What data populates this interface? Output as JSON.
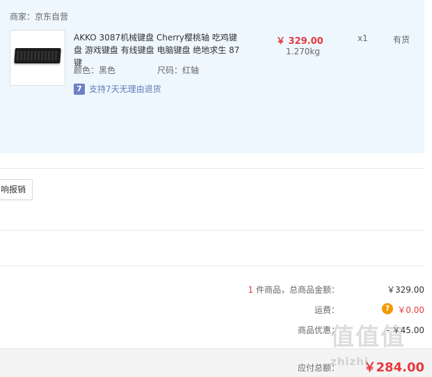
{
  "seller": "商家：京东自营",
  "product": {
    "title": "AKKO 3087机械键盘 Cherry樱桃轴 吃鸡键盘 游戏键盘 有线键盘 电脑键盘 绝地求生 87键",
    "color": "颜色：黑色",
    "size": "尺码：红轴",
    "return_icon_text": "7",
    "return_policy": "支持7天无理由退货",
    "price": "￥ 329.00",
    "weight": "1.270kg",
    "quantity": "x1",
    "stock": "有货"
  },
  "button": {
    "label": "响报销"
  },
  "summary": {
    "item_count": "1",
    "item_count_suffix": " 件商品，总商品金额：",
    "goods_total": "￥329.00",
    "shipping_label": "运费：",
    "shipping_help": "?",
    "shipping_value": "￥0.00",
    "discount_label": "商品优惠：",
    "discount_value": "- ￥45.00",
    "total_label": "应付总额：",
    "total_value": "￥284.00"
  },
  "watermark": {
    "large": "值值值",
    "small": "zhizhi"
  },
  "colors": {
    "accent": "#e4393c",
    "panel": "#eef7fd",
    "return_icon": "#6d80c4",
    "shipping_help": "#f39800"
  }
}
